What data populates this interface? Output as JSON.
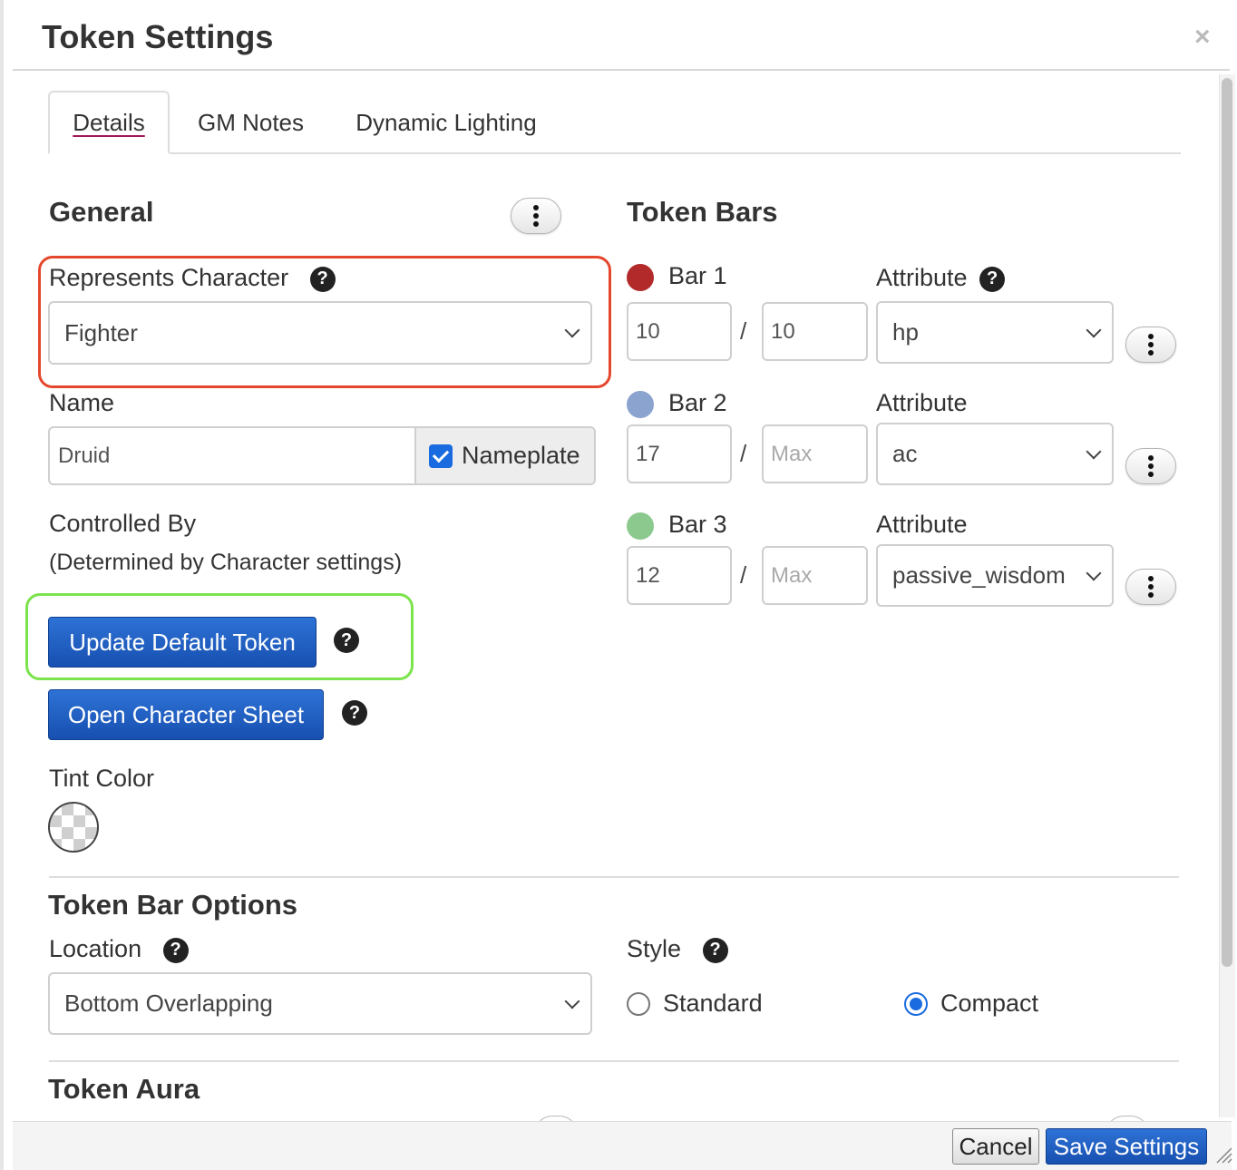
{
  "dialog": {
    "title": "Token Settings",
    "close_glyph": "×"
  },
  "tabs": [
    {
      "label": "Details",
      "active": true
    },
    {
      "label": "GM Notes",
      "active": false
    },
    {
      "label": "Dynamic Lighting",
      "active": false
    }
  ],
  "general": {
    "heading": "General",
    "represents_label": "Represents Character",
    "represents_value": "Fighter",
    "name_label": "Name",
    "name_value": "Druid",
    "nameplate_label": "Nameplate",
    "nameplate_checked": true,
    "controlled_by_label": "Controlled By",
    "controlled_by_value": "(Determined by Character settings)",
    "update_default_token_label": "Update Default Token",
    "open_character_sheet_label": "Open Character Sheet",
    "tint_color_label": "Tint Color"
  },
  "token_bars": {
    "heading": "Token Bars",
    "bars": [
      {
        "label": "Bar 1",
        "color": "#b22a2a",
        "value": "10",
        "max": "10",
        "max_placeholder": "Max",
        "attribute_label": "Attribute",
        "attribute": "hp",
        "attribute_help": true
      },
      {
        "label": "Bar 2",
        "color": "#8aa3cf",
        "value": "17",
        "max": "",
        "max_placeholder": "Max",
        "attribute_label": "Attribute",
        "attribute": "ac",
        "attribute_help": false
      },
      {
        "label": "Bar 3",
        "color": "#8cc98e",
        "value": "12",
        "max": "",
        "max_placeholder": "Max",
        "attribute_label": "Attribute",
        "attribute": "passive_wisdom",
        "attribute_help": false
      }
    ],
    "separator": "/"
  },
  "token_bar_options": {
    "heading": "Token Bar Options",
    "location_label": "Location",
    "location_value": "Bottom Overlapping",
    "style_label": "Style",
    "style_options": [
      {
        "label": "Standard",
        "selected": false
      },
      {
        "label": "Compact",
        "selected": true
      }
    ]
  },
  "token_aura": {
    "heading": "Token Aura"
  },
  "footer": {
    "cancel_label": "Cancel",
    "save_label": "Save Settings"
  },
  "help_glyph": "?",
  "colors": {
    "accent_blue": "#1a6be0",
    "highlight_red": "#e5472d",
    "highlight_green": "#7be34b",
    "tab_underline": "#a0185a"
  }
}
